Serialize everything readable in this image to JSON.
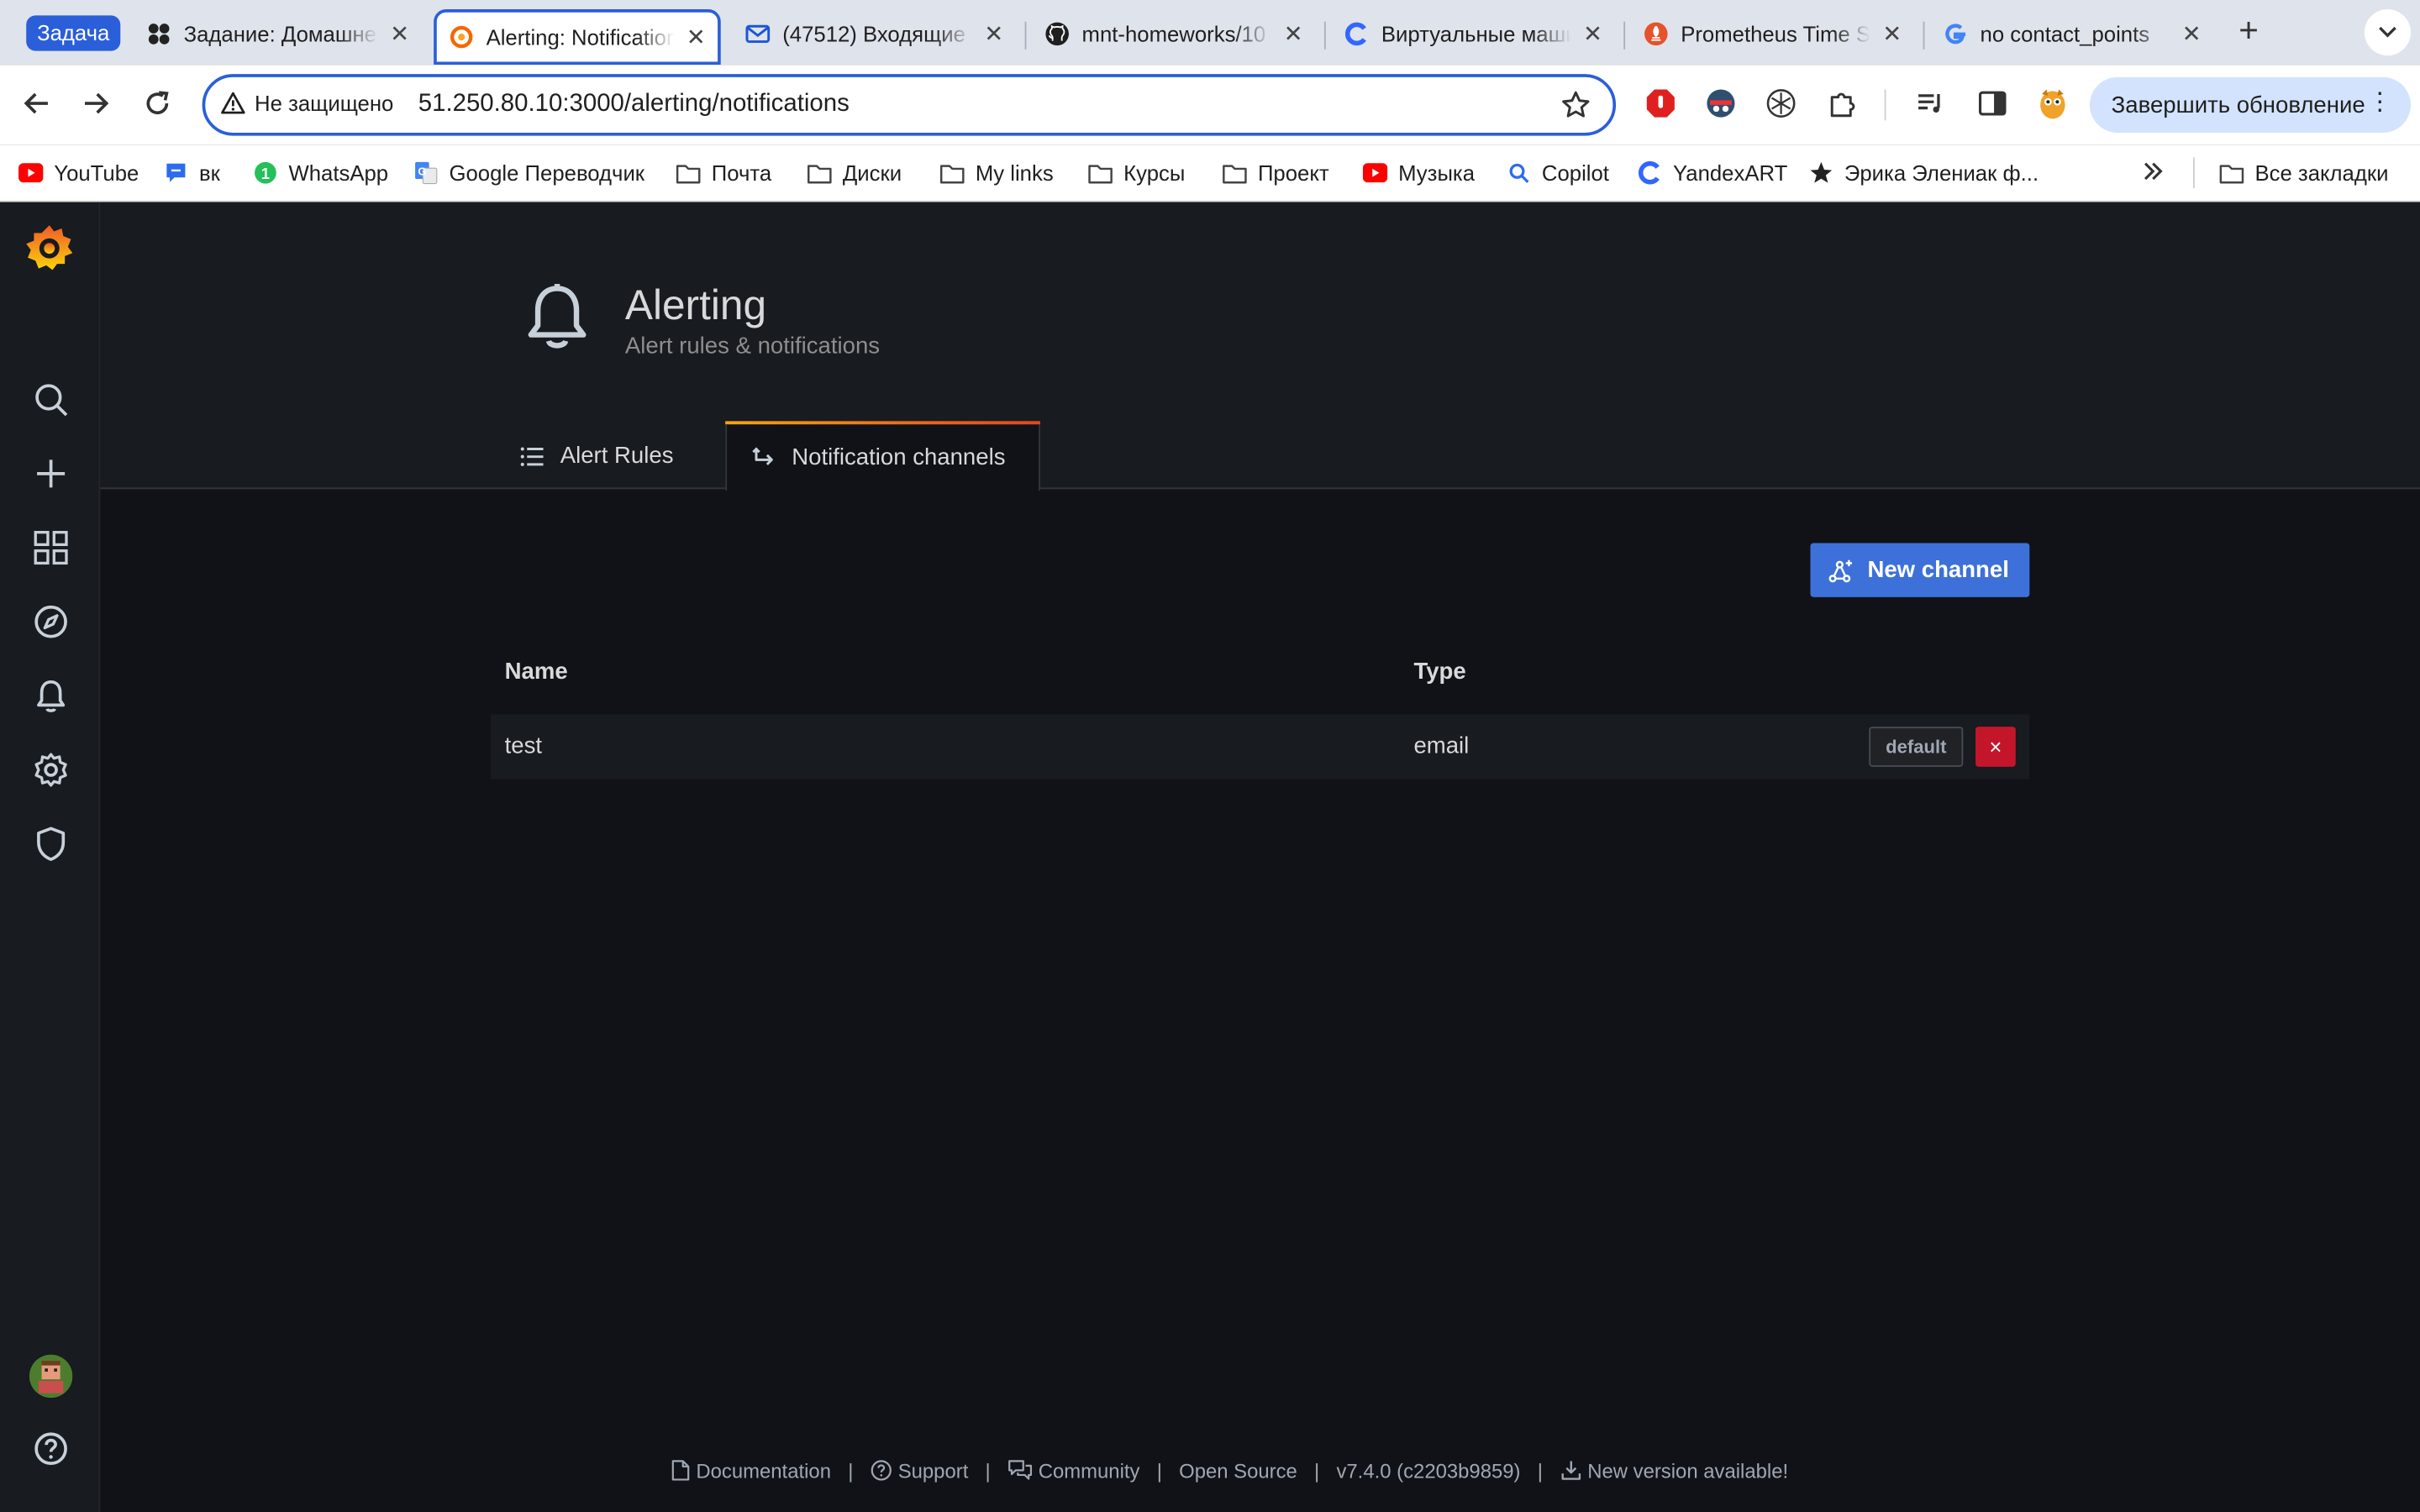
{
  "browser": {
    "group_label": "Задача",
    "tabs": [
      {
        "title": "Задание: Домашнее задание"
      },
      {
        "title": "Alerting: Notification channels"
      },
      {
        "title": "(47512) Входящие"
      },
      {
        "title": "mnt-homeworks/10"
      },
      {
        "title": "Виртуальные машины"
      },
      {
        "title": "Prometheus Time Series"
      },
      {
        "title": "no contact_points"
      }
    ],
    "security_label": "Не защищено",
    "url": "51.250.80.10:3000/alerting/notifications",
    "update_label": "Завершить обновление",
    "bookmarks": [
      {
        "label": "YouTube"
      },
      {
        "label": "вк"
      },
      {
        "label": "WhatsApp"
      },
      {
        "label": "Google Переводчик"
      },
      {
        "label": "Почта"
      },
      {
        "label": "Диски"
      },
      {
        "label": "My links"
      },
      {
        "label": "Курсы"
      },
      {
        "label": "Проект"
      },
      {
        "label": "Музыка"
      },
      {
        "label": "Copilot"
      },
      {
        "label": "YandexART"
      },
      {
        "label": "Эрика Элениак ф..."
      }
    ],
    "all_bookmarks_label": "Все закладки"
  },
  "page": {
    "title": "Alerting",
    "subtitle": "Alert rules & notifications",
    "tabs": [
      {
        "label": "Alert Rules"
      },
      {
        "label": "Notification channels"
      }
    ],
    "new_channel_label": "New channel"
  },
  "table": {
    "headers": {
      "name": "Name",
      "type": "Type"
    },
    "rows": [
      {
        "name": "test",
        "type": "email",
        "badge": "default",
        "delete": "×"
      }
    ]
  },
  "footer": {
    "items": [
      {
        "label": "Documentation"
      },
      {
        "label": "Support"
      },
      {
        "label": "Community"
      },
      {
        "label": "Open Source"
      },
      {
        "label": "v7.4.0 (c2203b9859)"
      },
      {
        "label": "New version available!"
      }
    ],
    "separator": "|"
  },
  "colors": {
    "accent": "#3d71d9",
    "danger": "#c4162a",
    "background": "#111217",
    "panel": "#181b1f"
  }
}
